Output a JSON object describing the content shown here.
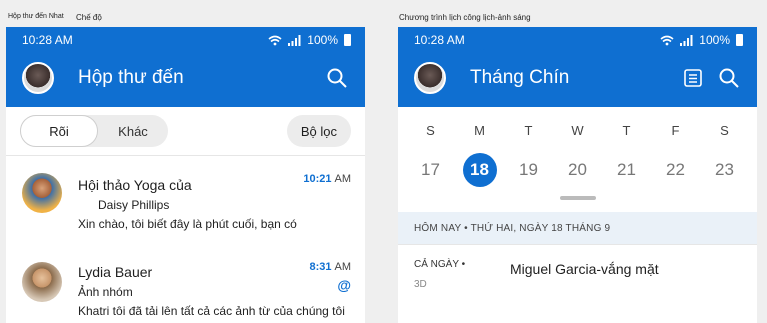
{
  "captions": {
    "left_a": "Hộp thư đến Nhat",
    "left_b": "Chế độ",
    "right": "Chương trình lịch công lịch-ảnh sáng"
  },
  "colors": {
    "accent": "#0f6fd1",
    "today_strip": "#eaf1f8"
  },
  "inbox": {
    "status": {
      "time": "10:28 AM",
      "battery": "100%"
    },
    "title": "Hộp thư đến",
    "filter_tabs": [
      "Rõi",
      "Khác"
    ],
    "filter_button": "Bộ lọc",
    "messages": [
      {
        "sender": "Hội thảo Yoga của",
        "line2": "Daisy Phillips",
        "line3": "Xin chào, tôi biết đây là phút cuối, bạn có",
        "time": "10:21",
        "ampm": "AM"
      },
      {
        "sender": "Lydia Bauer",
        "line2": "Ảnh nhóm",
        "line3": "Khatri tôi đã tải lên tất cả các ảnh từ của chúng tôi",
        "time": "8:31",
        "ampm": "AM",
        "mention": "@"
      }
    ]
  },
  "calendar": {
    "status": {
      "time": "10:28 AM",
      "battery": "100%"
    },
    "title": "Tháng Chín",
    "weekdays": [
      "S",
      "M",
      "T",
      "W",
      "T",
      "F",
      "S"
    ],
    "days": [
      "17",
      "18",
      "19",
      "20",
      "21",
      "22",
      "23"
    ],
    "today_label": "HÔM NAY • THỨ HAI, NGÀY 18 THÁNG 9",
    "event": {
      "allday": "CẢ NGÀY •",
      "duration": "3D",
      "title": "Miguel Garcia-vắng mặt"
    }
  }
}
